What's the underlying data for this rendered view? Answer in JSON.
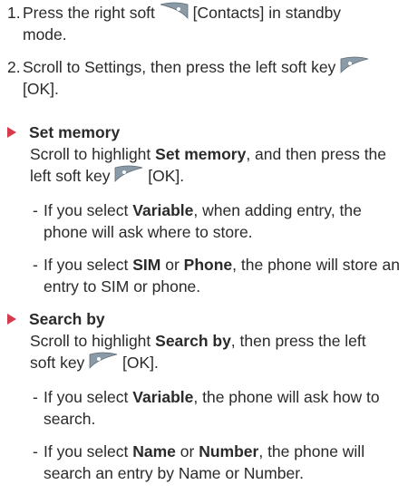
{
  "steps": [
    {
      "num": "1.",
      "a": "Press the right soft ",
      "b": " [Contacts] in standby",
      "c": "mode."
    },
    {
      "num": "2.",
      "a": "Scroll to Settings, then press the left soft key ",
      "b": "[OK]."
    }
  ],
  "sections": [
    {
      "title": "Set memory",
      "body": {
        "pre": "Scroll to highlight ",
        "bold": "Set memory",
        "post": ", and then press the",
        "line2a": "left soft key ",
        "line2b": " [OK]."
      },
      "items": [
        {
          "dash": "-",
          "pre": "If you select ",
          "b1": "Variable",
          "mid": ", when adding entry, the",
          "line2": "phone will ask where to store."
        },
        {
          "dash": "-",
          "pre": "If you select ",
          "b1": "SIM",
          "mid": " or ",
          "b2": "Phone",
          "post": ", the phone will store an",
          "line2": "entry to SIM or phone."
        }
      ]
    },
    {
      "title": "Search by",
      "body": {
        "pre": "Scroll to highlight ",
        "bold": "Search by",
        "post": ", then press the left",
        "line2a": "soft key ",
        "line2b": " [OK]."
      },
      "items": [
        {
          "dash": "-",
          "pre": "If you select ",
          "b1": "Variable",
          "mid": ", the phone will ask how to",
          "line2": "search."
        },
        {
          "dash": "-",
          "pre": "If you select ",
          "b1": "Name",
          "mid": " or ",
          "b2": "Number",
          "post": ", the phone will",
          "line2": "search an entry by Name or Number."
        }
      ]
    }
  ],
  "colors": {
    "bullet": "#d73a4a",
    "text": "#2a2a2a",
    "key_fill": "#8a9aa6",
    "key_dot": "#ffffff"
  },
  "icons": {
    "right_soft_key": "right-soft-key-icon",
    "left_soft_key": "left-soft-key-icon",
    "bullet": "triangle-bullet-icon"
  }
}
